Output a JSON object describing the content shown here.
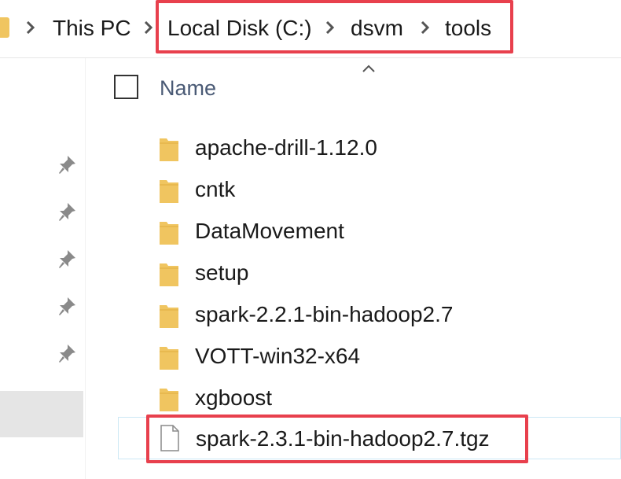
{
  "breadcrumb": {
    "items": [
      {
        "label": "This PC"
      },
      {
        "label": "Local Disk (C:)"
      },
      {
        "label": "dsvm"
      },
      {
        "label": "tools"
      }
    ]
  },
  "list": {
    "column_name_label": "Name",
    "rows": [
      {
        "name": "apache-drill-1.12.0",
        "type": "folder"
      },
      {
        "name": "cntk",
        "type": "folder"
      },
      {
        "name": "DataMovement",
        "type": "folder"
      },
      {
        "name": "setup",
        "type": "folder"
      },
      {
        "name": "spark-2.2.1-bin-hadoop2.7",
        "type": "folder"
      },
      {
        "name": "VOTT-win32-x64",
        "type": "folder"
      },
      {
        "name": "xgboost",
        "type": "folder"
      },
      {
        "name": "spark-2.3.1-bin-hadoop2.7.tgz",
        "type": "file"
      }
    ]
  },
  "colors": {
    "highlight": "#e8404d",
    "folder": "#f0c560",
    "header_text": "#4a5a75"
  }
}
